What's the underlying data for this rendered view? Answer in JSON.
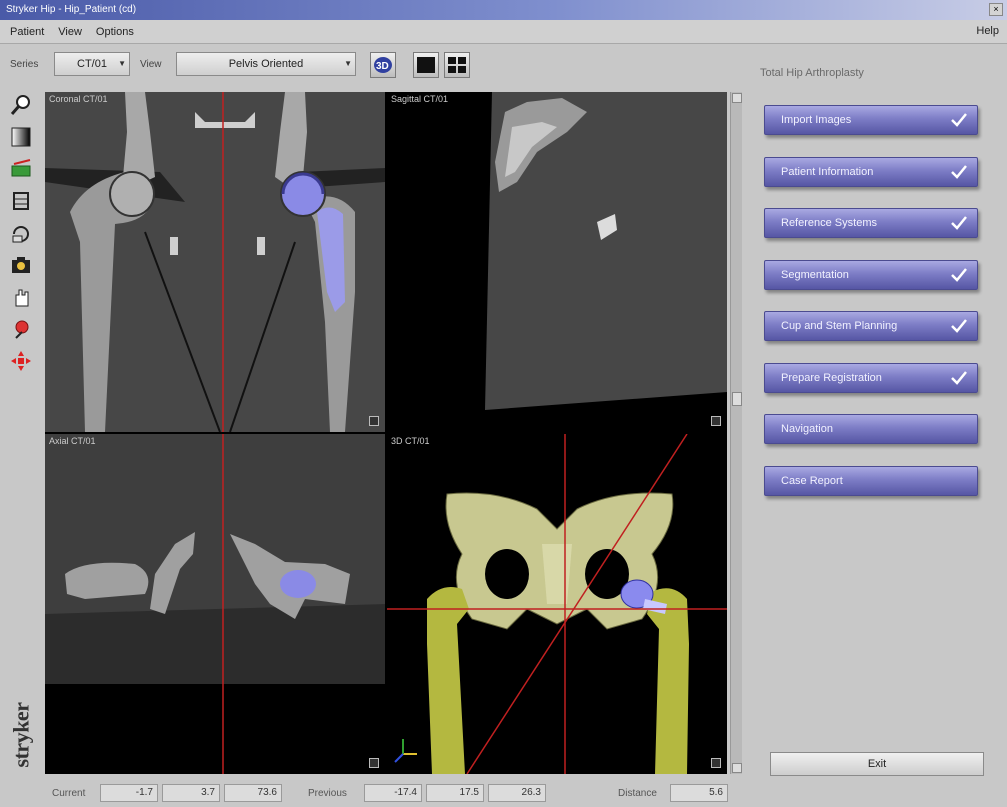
{
  "window": {
    "title": "Stryker Hip - Hip_Patient (cd)"
  },
  "menu": {
    "items": [
      "Patient",
      "View",
      "Options"
    ],
    "help": "Help"
  },
  "toolbar": {
    "series_label": "Series",
    "series_value": "CT/01",
    "view_label": "View",
    "view_value": "Pelvis Oriented",
    "procedure_title": "Total Hip Arthroplasty"
  },
  "viewports": {
    "top_left_label": "Coronal CT/01",
    "top_right_label": "Sagittal CT/01",
    "bottom_left_label": "Axial CT/01",
    "bottom_right_label": "3D CT/01"
  },
  "steps": [
    {
      "label": "Import Images",
      "done": true
    },
    {
      "label": "Patient Information",
      "done": true
    },
    {
      "label": "Reference Systems",
      "done": true
    },
    {
      "label": "Segmentation",
      "done": true
    },
    {
      "label": "Cup and Stem Planning",
      "done": true
    },
    {
      "label": "Prepare Registration",
      "done": true
    },
    {
      "label": "Navigation",
      "done": false
    },
    {
      "label": "Case Report",
      "done": false
    }
  ],
  "exit_label": "Exit",
  "status": {
    "current_label": "Current",
    "current_values": [
      "-1.7",
      "3.7",
      "73.6"
    ],
    "previous_label": "Previous",
    "previous_values": [
      "-17.4",
      "17.5",
      "26.3"
    ],
    "distance_label": "Distance",
    "distance_value": "5.6"
  },
  "brand": "stryker",
  "colors": {
    "step_blue": "#7d7dc6",
    "crosshair_red": "#c02020",
    "implant_blue": "#8888ee",
    "bone_3d": "#c8c890"
  }
}
